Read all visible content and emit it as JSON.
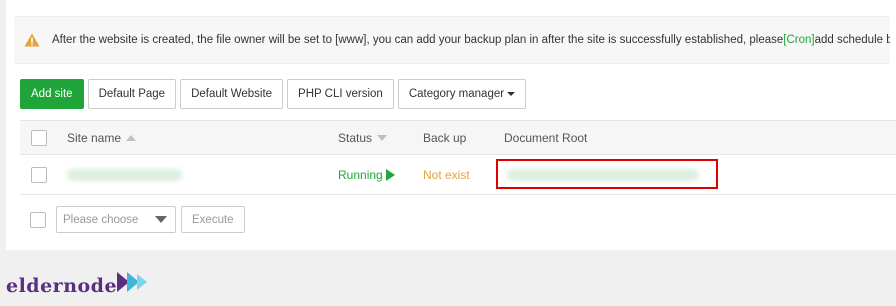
{
  "notice": {
    "text_before": "After the website is created, the file owner will be set to [www], you can add your backup plan in after the site is successfully established, please",
    "link": "[Cron]",
    "text_after": "add schedule backup task.",
    "icon": "warning-icon"
  },
  "toolbar": {
    "add_site": "Add site",
    "default_page": "Default Page",
    "default_website": "Default Website",
    "php_cli": "PHP CLI version",
    "category_manager": "Category manager"
  },
  "table": {
    "headers": {
      "site_name": "Site name",
      "status": "Status",
      "backup": "Back up",
      "doc_root": "Document Root"
    },
    "rows": [
      {
        "status": "Running",
        "backup": "Not exist"
      }
    ]
  },
  "footer": {
    "select_placeholder": "Please choose",
    "execute": "Execute"
  },
  "logo": {
    "text": "eldernode"
  },
  "colors": {
    "accent": "#20a53a",
    "warning": "#e8a33a",
    "highlight": "#e00000",
    "brand": "#5a2f80"
  }
}
